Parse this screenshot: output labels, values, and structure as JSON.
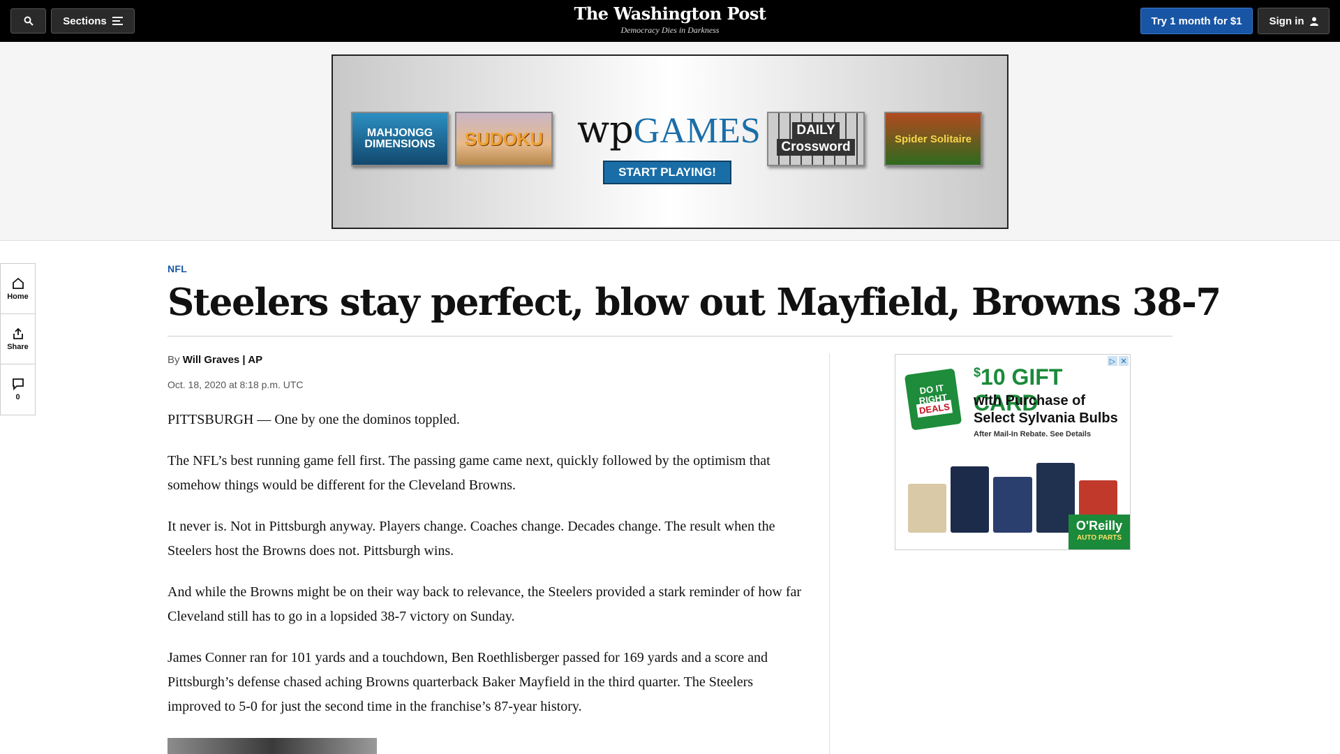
{
  "header": {
    "sections_label": "Sections",
    "masthead": "The Washington Post",
    "tagline": "Democracy Dies in Darkness",
    "subscribe_label": "Try 1 month for $1",
    "signin_label": "Sign in"
  },
  "top_ad": {
    "tiles": [
      "MAHJONGG",
      "DIMENSIONS",
      "SUDOKU",
      "DAILY",
      "Crossword",
      "Spider Solitaire"
    ],
    "brand_wp": "wp",
    "brand_games": "GAMES",
    "cta": "START PLAYING!"
  },
  "rail": {
    "home": "Home",
    "share": "Share",
    "comments_count": "0"
  },
  "article": {
    "kicker": "NFL",
    "headline": "Steelers stay perfect, blow out Mayfield, Browns 38-7",
    "byline_prefix": "By",
    "author": "Will Graves | AP",
    "date": "Oct. 18, 2020 at 8:18 p.m. UTC",
    "paragraphs": [
      "PITTSBURGH — One by one the dominos toppled.",
      "The NFL’s best running game fell first. The passing game came next, quickly followed by the optimism that somehow things would be different for the Cleveland Browns.",
      "It never is. Not in Pittsburgh anyway. Players change. Coaches change. Decades change. The result when the Steelers host the Browns does not. Pittsburgh wins.",
      "And while the Browns might be on their way back to relevance, the Steelers provided a stark reminder of how far Cleveland still has to go in a lopsided 38-7 victory on Sunday.",
      "James Conner ran for 101 yards and a touchdown, Ben Roethlisberger passed for 169 yards and a score and Pittsburgh’s defense chased aching Browns quarterback Baker Mayfield in the third quarter. The Steelers improved to 5-0 for just the second time in the franchise’s 87-year history."
    ]
  },
  "side_ad": {
    "badge_line1": "DO IT",
    "badge_line2": "RIGHT",
    "badge_line3": "DEALS",
    "gift_amount": "10 GIFT CARD",
    "gift_dollar": "$",
    "line1": "with Purchase of",
    "line2": "Select Sylvania Bulbs",
    "fine_print": "After Mail-In Rebate. See Details",
    "retailer": "O'Reilly",
    "retailer_sub": "AUTO PARTS"
  },
  "colors": {
    "accent": "#1955a5",
    "nav_bg": "#000000",
    "text": "#111111"
  },
  "icons": [
    "search-icon",
    "menu-icon",
    "user-icon",
    "home-icon",
    "share-icon",
    "comment-icon"
  ]
}
